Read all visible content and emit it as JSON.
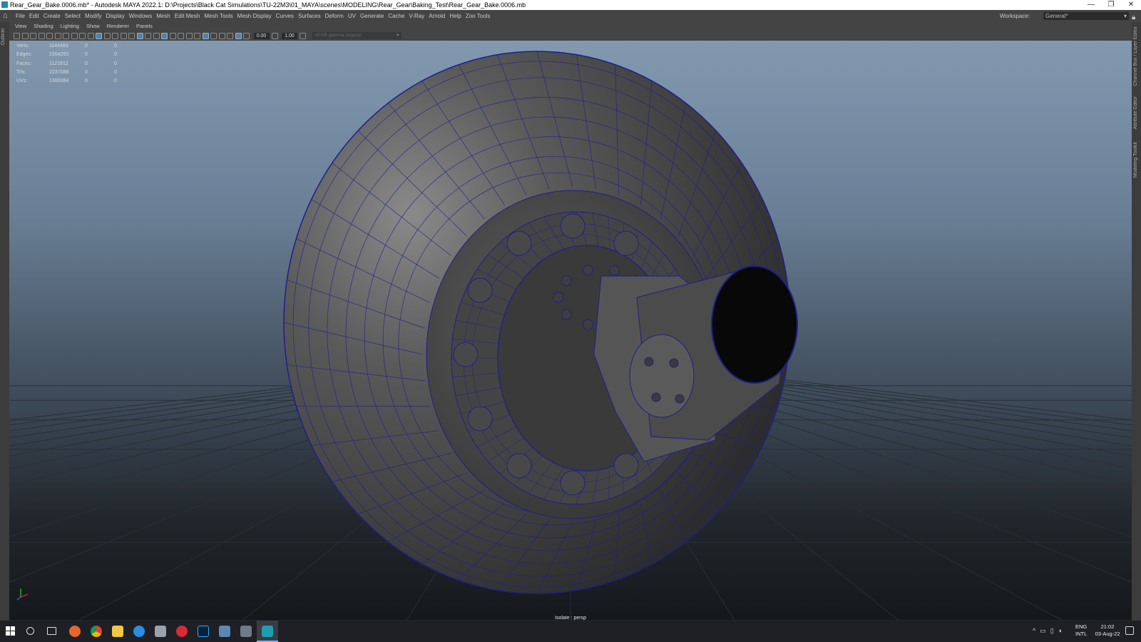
{
  "window": {
    "title": "Rear_Gear_Bake.0006.mb* - Autodesk MAYA 2022.1: D:\\Projects\\Black Cat Simulations\\TU-22M3\\01_MAYA\\scenes\\MODELING\\Rear_Gear\\Baking_Test\\Rear_Gear_Bake.0006.mb",
    "minimize": "—",
    "restore": "❐",
    "close": "✕"
  },
  "menubar": {
    "items": [
      "File",
      "Edit",
      "Create",
      "Select",
      "Modify",
      "Display",
      "Windows",
      "Mesh",
      "Edit Mesh",
      "Mesh Tools",
      "Mesh Display",
      "Curves",
      "Surfaces",
      "Deform",
      "UV",
      "Generate",
      "Cache",
      "V-Ray",
      "Arnold",
      "Help",
      "Zoo Tools"
    ],
    "workspace_label": "Workspace:",
    "workspace_value": "General*"
  },
  "side_labels": {
    "left": "Outliner",
    "right": [
      "Channel Box / Layer Editor",
      "Attribute Editor",
      "Modeling Toolkit"
    ]
  },
  "panel_menu": [
    "View",
    "Shading",
    "Lighting",
    "Show",
    "Renderer",
    "Panels"
  ],
  "toolbar": {
    "value_a": "0.00",
    "value_b": "1.00",
    "color_space": "sRGB gamma (legacy)"
  },
  "hud": {
    "rows": [
      {
        "label": "Verts:",
        "v1": "1144483",
        "v2": "0",
        "v3": "0"
      },
      {
        "label": "Edges:",
        "v1": "2264293",
        "v2": "0",
        "v3": "0"
      },
      {
        "label": "Faces:",
        "v1": "1121912",
        "v2": "0",
        "v3": "0"
      },
      {
        "label": "Tris:",
        "v1": "2237088",
        "v2": "0",
        "v3": "0"
      },
      {
        "label": "UVs:",
        "v1": "1300084",
        "v2": "0",
        "v3": "0"
      }
    ]
  },
  "viewport": {
    "camera_label": "Isolate : persp"
  },
  "taskbar": {
    "lang_top": "ENG",
    "lang_bottom": "INTL",
    "time": "21:02",
    "date": "03-Aug-22",
    "icons": [
      "start-icon",
      "search-icon",
      "task-view-icon",
      "firefox-icon",
      "chrome-icon",
      "file-explorer-icon",
      "edge-icon",
      "app-icon",
      "vivaldi-icon",
      "photoshop-icon",
      "window-icon",
      "calculator-icon",
      "maya-icon"
    ]
  },
  "colors": {
    "viewport_top": "#8299b0",
    "viewport_bottom": "#15181b",
    "wire": "#1f1f8a",
    "accent": "#76b9ed"
  }
}
